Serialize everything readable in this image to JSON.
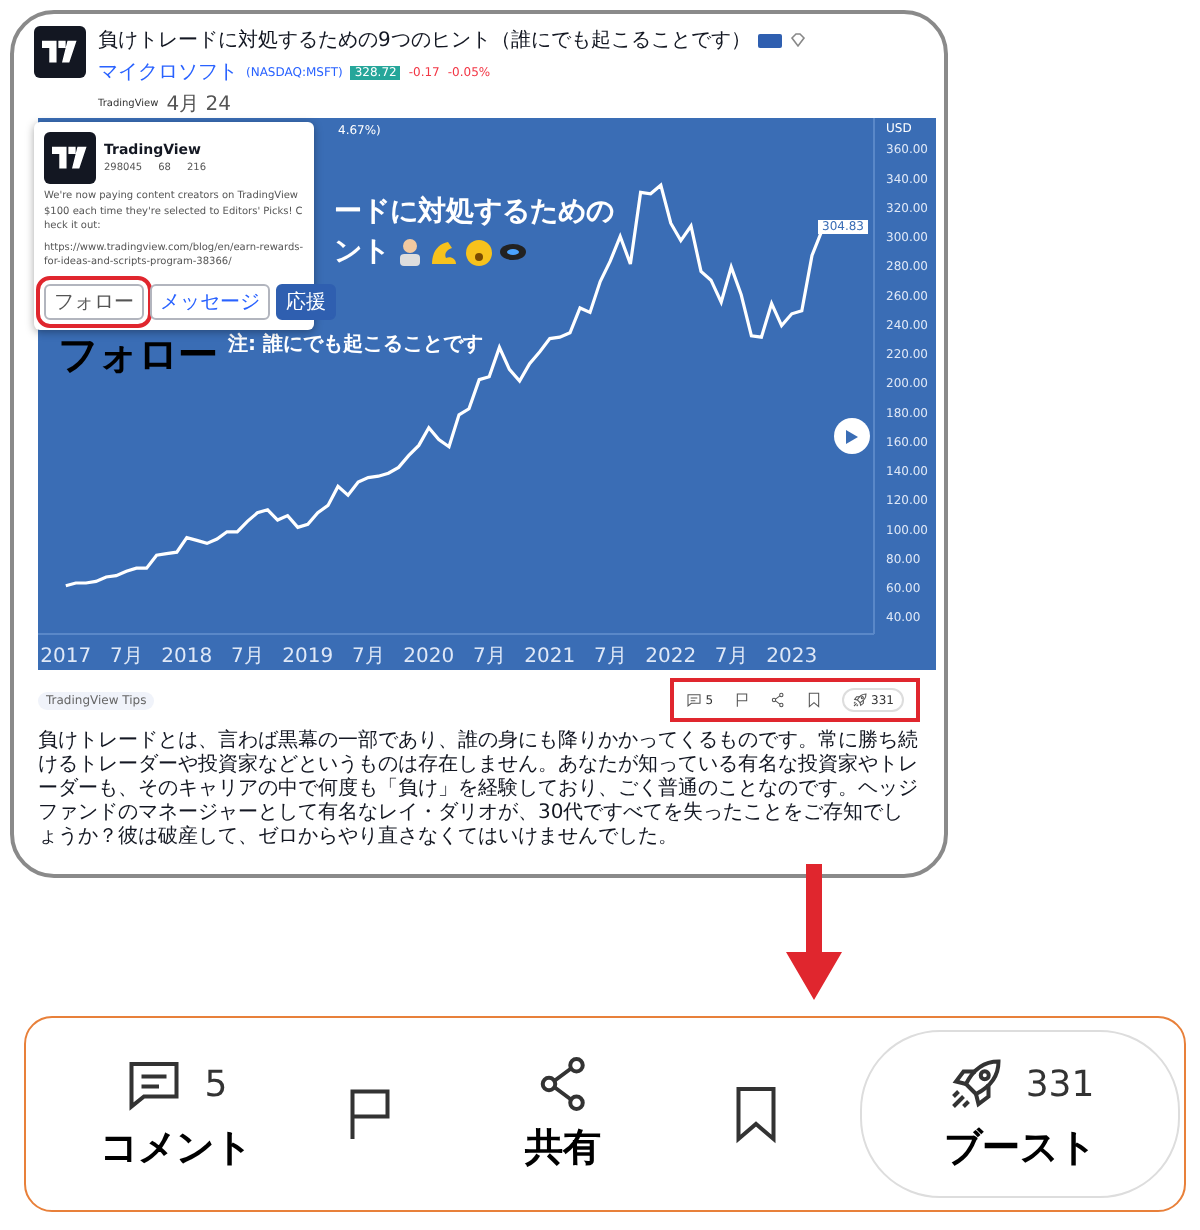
{
  "post": {
    "title": "負けトレードに対処するための9つのヒント（誰にでも起こることです）",
    "symbol_name": "マイクロソフト",
    "symbol": "(NASDAQ:MSFT)",
    "price": "328.72",
    "change": "-0.17",
    "change_pct": "-0.05%",
    "author": "TradingView",
    "date": "4月 24"
  },
  "profile_popup": {
    "name": "TradingView",
    "stats": [
      "298045",
      "68",
      "216"
    ],
    "bio": "We're now paying content creators on TradingView $100 each time they're selected to Editors' Picks! Check it out:",
    "link": "https://www.tradingview.com/blog/en/earn-rewards-for-ideas-and-scripts-program-38366/",
    "buttons": [
      {
        "label": "フォロー",
        "kind": "outline",
        "highlighted": true
      },
      {
        "label": "メッセージ",
        "kind": "outline",
        "highlighted": false
      },
      {
        "label": "応援",
        "kind": "primary",
        "highlighted": false
      }
    ]
  },
  "annotation_label": "フォロー",
  "chart_overlay": {
    "legend": "4.67%)",
    "lines": [
      "ードに対処するための",
      "ント"
    ],
    "subtitle": "注: 誰にでも起こることです"
  },
  "chart": {
    "price_label": "304.83",
    "chart_data": {
      "type": "line",
      "ylabel": "USD",
      "ylim": [
        29.06,
        381.9
      ],
      "xlim": [
        2016.77,
        2023.68
      ],
      "x": [
        2017,
        2017.083,
        2017.167,
        2017.25,
        2017.333,
        2017.417,
        2017.5,
        2017.583,
        2017.667,
        2017.75,
        2017.833,
        2017.917,
        2018,
        2018.083,
        2018.167,
        2018.25,
        2018.333,
        2018.417,
        2018.5,
        2018.583,
        2018.667,
        2018.75,
        2018.833,
        2018.917,
        2019,
        2019.083,
        2019.167,
        2019.25,
        2019.333,
        2019.417,
        2019.5,
        2019.583,
        2019.667,
        2019.75,
        2019.833,
        2019.917,
        2020,
        2020.083,
        2020.167,
        2020.25,
        2020.333,
        2020.417,
        2020.5,
        2020.583,
        2020.667,
        2020.75,
        2020.833,
        2020.917,
        2021,
        2021.083,
        2021.167,
        2021.25,
        2021.333,
        2021.417,
        2021.5,
        2021.583,
        2021.667,
        2021.75,
        2021.833,
        2021.917,
        2022,
        2022.083,
        2022.167,
        2022.25,
        2022.333,
        2022.417,
        2022.5,
        2022.583,
        2022.667,
        2022.75,
        2022.833,
        2022.917,
        2023,
        2023.083,
        2023.167,
        2023.25
      ],
      "series": [
        {
          "color": "#ffffff",
          "values": [
            62,
            64,
            64,
            65,
            68,
            69,
            72,
            74,
            74,
            83,
            84,
            85,
            95,
            93,
            91,
            94,
            99,
            99,
            106,
            112,
            114,
            107,
            110,
            102,
            104,
            112,
            117,
            130,
            124,
            133,
            136,
            137,
            139,
            143,
            151,
            158,
            170,
            162,
            157,
            179,
            183,
            203,
            205,
            225,
            210,
            202,
            214,
            222,
            231,
            232,
            235,
            252,
            249,
            270,
            284,
            301,
            282,
            331,
            330,
            336,
            310,
            298,
            308,
            277,
            271,
            256,
            280,
            261,
            233,
            232,
            255,
            240,
            248,
            250,
            288,
            305
          ]
        }
      ],
      "xticks": [
        2017,
        2018,
        2019,
        2020,
        2021,
        2022,
        2023
      ],
      "yticks": [
        {
          "value": 40,
          "label": "40.00"
        },
        {
          "value": 60,
          "label": "60.00"
        },
        {
          "value": 80,
          "label": "80.00"
        },
        {
          "value": 100,
          "label": "100.00"
        },
        {
          "value": 120,
          "label": "120.00"
        },
        {
          "value": 140,
          "label": "140.00"
        },
        {
          "value": 160,
          "label": "160.00"
        },
        {
          "value": 180,
          "label": "180.00"
        },
        {
          "value": 200,
          "label": "200.00"
        },
        {
          "value": 220,
          "label": "220.00"
        },
        {
          "value": 240,
          "label": "240.00"
        },
        {
          "value": 260,
          "label": "260.00"
        },
        {
          "value": 280,
          "label": "280.00"
        },
        {
          "value": 300,
          "label": "300.00"
        },
        {
          "value": 320,
          "label": "320.00"
        },
        {
          "value": 340,
          "label": "340.00"
        },
        {
          "value": 360,
          "label": "360.00"
        }
      ]
    }
  },
  "month_labels": [
    "7月",
    "7月",
    "7月",
    "7月",
    "7月",
    "7月"
  ],
  "tag": "TradingView Tips",
  "actions_highlighted": true,
  "actions": [
    {
      "kind": "comment",
      "count": "5"
    },
    {
      "kind": "flag"
    },
    {
      "kind": "share"
    },
    {
      "kind": "bookmark"
    },
    {
      "kind": "boost",
      "count": "331"
    }
  ],
  "body": "負けトレードとは、言わば黒幕の一部であり、誰の身にも降りかかってくるものです。常に勝ち続けるトレーダーや投資家などというものは存在しません。あなたが知っている有名な投資家やトレーダーも、そのキャリアの中で何度も「負け」を経験しており、ごく普通のことなのです。ヘッジファンドのマネージャーとして有名なレイ・ダリオが、30代ですべてを失ったことをご存知でしょうか？彼は破産して、ゼロからやり直さなくてはいけませんでした。",
  "zoomed_actions": [
    {
      "kind": "comment",
      "count": "5",
      "label": "コメント"
    },
    {
      "kind": "flag"
    },
    {
      "kind": "share",
      "label": "共有"
    },
    {
      "kind": "bookmark"
    },
    {
      "kind": "boost",
      "count": "331",
      "label": "ブースト"
    }
  ]
}
